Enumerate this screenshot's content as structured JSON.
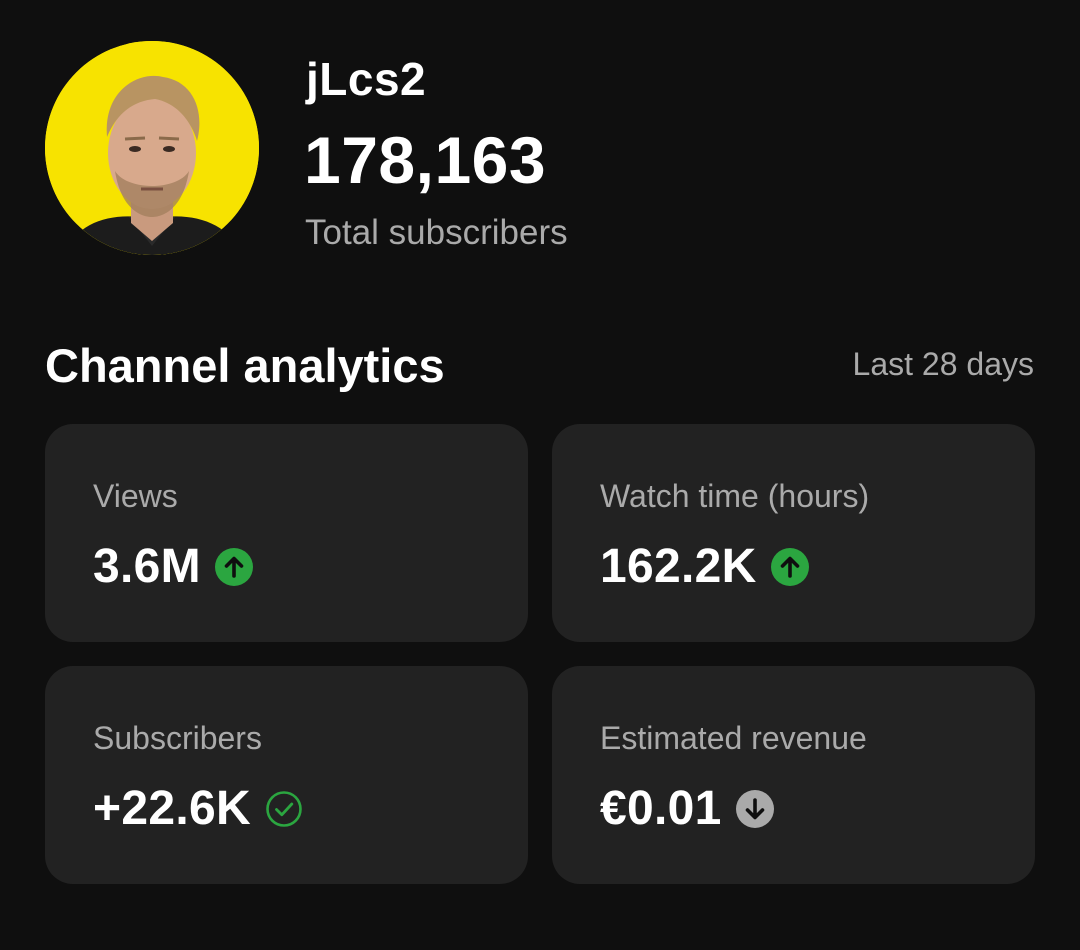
{
  "channel": {
    "name": "jLcs2",
    "subscriber_count": "178,163",
    "subscriber_label": "Total subscribers",
    "avatar_bg": "#f7e300"
  },
  "analytics": {
    "title": "Channel analytics",
    "range": "Last 28 days",
    "cards": [
      {
        "label": "Views",
        "value": "3.6M",
        "indicator": "up-arrow-icon",
        "indicator_color": "#2ba640"
      },
      {
        "label": "Watch time (hours)",
        "value": "162.2K",
        "indicator": "up-arrow-icon",
        "indicator_color": "#2ba640"
      },
      {
        "label": "Subscribers",
        "value": "+22.6K",
        "indicator": "check-circle-icon",
        "indicator_color": "#2ba640"
      },
      {
        "label": "Estimated revenue",
        "value": "€0.01",
        "indicator": "down-arrow-icon",
        "indicator_color": "#aaaaaa"
      }
    ]
  }
}
